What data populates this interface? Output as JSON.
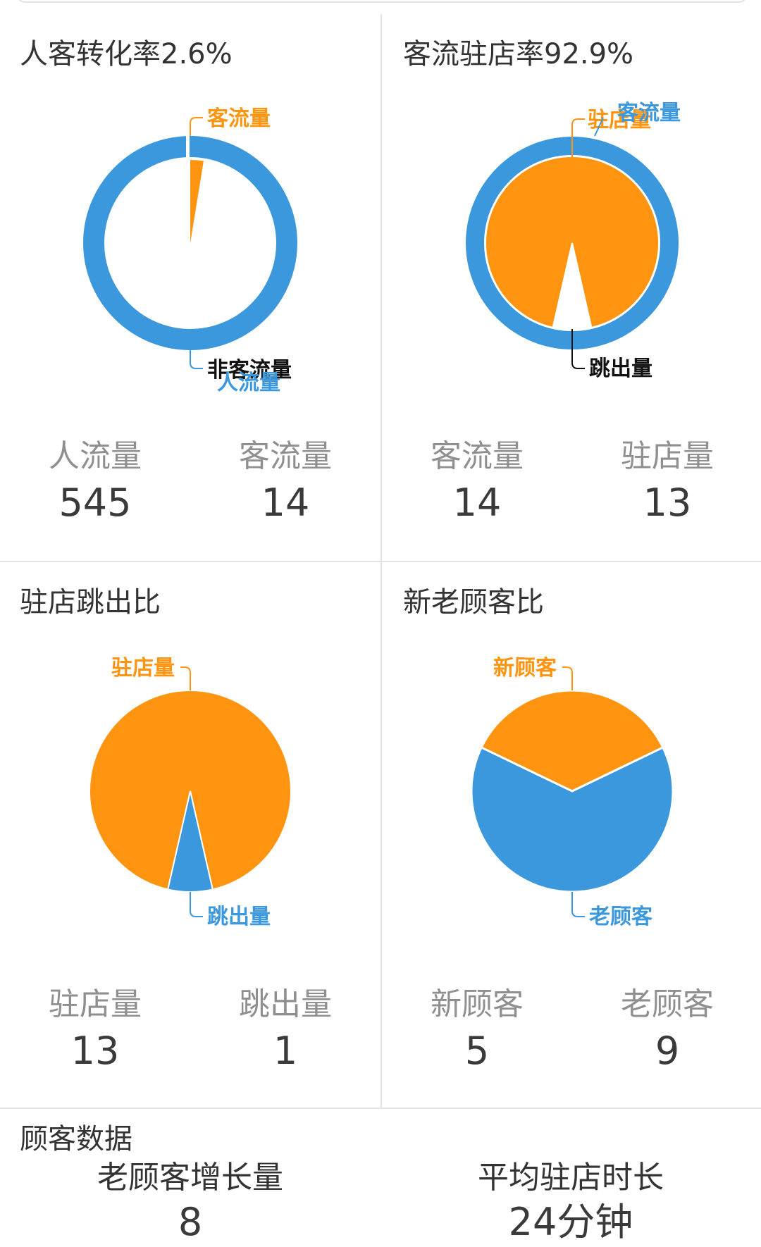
{
  "colors": {
    "blue": "#3b98dd",
    "orange": "#fe9410",
    "dark": "#111111"
  },
  "cells": [
    {
      "title": "人客转化率2.6%",
      "chart_data": {
        "type": "pie",
        "title": "人客转化率2.6%",
        "inner": {
          "slices": [
            {
              "label": "客流量",
              "value": 14,
              "color": "#fe9410"
            },
            {
              "label": "非客流量",
              "value": 531,
              "color": "#ffffff"
            }
          ]
        },
        "outer": {
          "slices": [
            {
              "label": "人流量",
              "value": 545,
              "color": "#3b98dd"
            }
          ]
        }
      },
      "stats": [
        {
          "label": "人流量",
          "value": "545"
        },
        {
          "label": "客流量",
          "value": "14"
        }
      ]
    },
    {
      "title": "客流驻店率92.9%",
      "chart_data": {
        "type": "pie",
        "title": "客流驻店率92.9%",
        "inner": {
          "slices": [
            {
              "label": "驻店量",
              "value": 13,
              "color": "#fe9410"
            },
            {
              "label": "跳出量",
              "value": 1,
              "color": "#ffffff"
            }
          ]
        },
        "outer": {
          "slices": [
            {
              "label": "客流量",
              "value": 14,
              "color": "#3b98dd"
            }
          ]
        }
      },
      "stats": [
        {
          "label": "客流量",
          "value": "14"
        },
        {
          "label": "驻店量",
          "value": "13"
        }
      ]
    },
    {
      "title": "驻店跳出比",
      "chart_data": {
        "type": "pie",
        "title": "驻店跳出比",
        "slices": [
          {
            "label": "驻店量",
            "value": 13,
            "color": "#fe9410"
          },
          {
            "label": "跳出量",
            "value": 1,
            "color": "#3b98dd"
          }
        ]
      },
      "stats": [
        {
          "label": "驻店量",
          "value": "13"
        },
        {
          "label": "跳出量",
          "value": "1"
        }
      ]
    },
    {
      "title": "新老顾客比",
      "chart_data": {
        "type": "pie",
        "title": "新老顾客比",
        "slices": [
          {
            "label": "新顾客",
            "value": 5,
            "color": "#fe9410"
          },
          {
            "label": "老顾客",
            "value": 9,
            "color": "#3b98dd"
          }
        ]
      },
      "stats": [
        {
          "label": "新顾客",
          "value": "5"
        },
        {
          "label": "老顾客",
          "value": "9"
        }
      ]
    }
  ],
  "customer_section": {
    "title": "顾客数据",
    "metrics": [
      {
        "label": "老顾客增长量",
        "value": "8"
      },
      {
        "label": "平均驻店时长",
        "value": "24分钟"
      }
    ]
  }
}
